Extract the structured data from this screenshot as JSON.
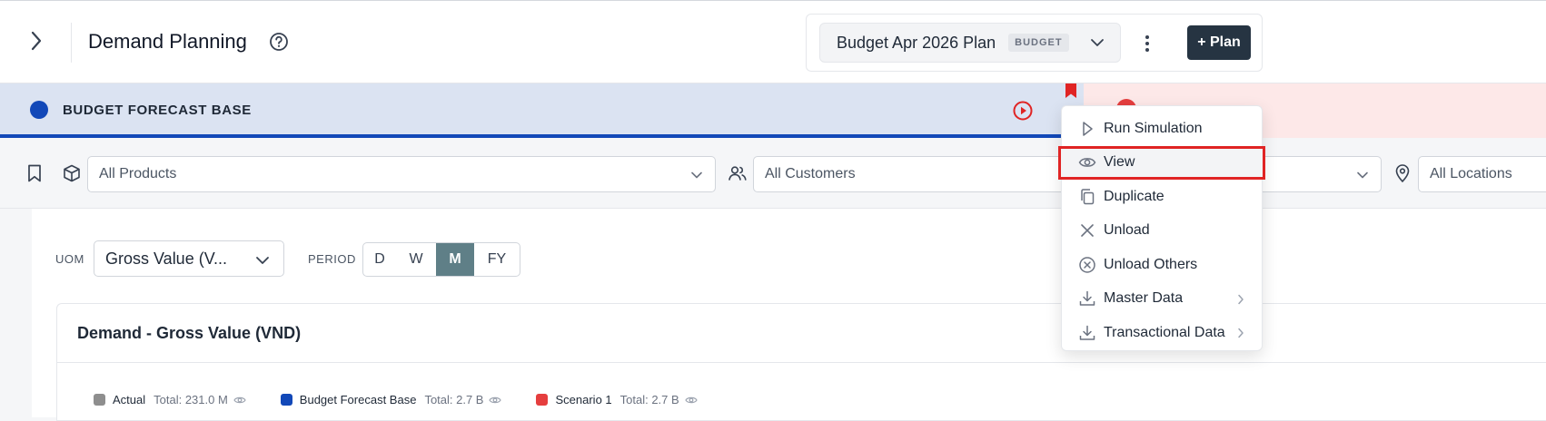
{
  "header": {
    "title": "Demand Planning",
    "plan_name": "Budget Apr 2026 Plan",
    "plan_badge": "BUDGET",
    "plan_button": "+ Plan"
  },
  "scenarios": {
    "base": {
      "label": "BUDGET FORECAST BASE",
      "color": "#1248b8"
    },
    "scenario1": {
      "color": "#e53e3e"
    }
  },
  "filters": {
    "products": "All Products",
    "customers": "All Customers",
    "locations": "All Locations"
  },
  "controls": {
    "uom_label": "UOM",
    "uom_value": "Gross Value (V...",
    "period_label": "PERIOD",
    "periods": [
      "D",
      "W",
      "M",
      "FY"
    ],
    "active_period": "M"
  },
  "chart": {
    "title": "Demand - Gross Value (VND)",
    "legend": [
      {
        "name": "Actual",
        "total": "Total: 231.0 M",
        "color": "#8e8e8e"
      },
      {
        "name": "Budget Forecast Base",
        "total": "Total: 2.7 B",
        "color": "#1248b8"
      },
      {
        "name": "Scenario 1",
        "total": "Total: 2.7 B",
        "color": "#e53e3e"
      }
    ]
  },
  "context_menu": {
    "items": [
      {
        "label": "Run Simulation",
        "icon": "play-outline-icon"
      },
      {
        "label": "View",
        "icon": "eye-icon",
        "highlighted": true
      },
      {
        "label": "Duplicate",
        "icon": "copy-icon"
      },
      {
        "label": "Unload",
        "icon": "close-icon"
      },
      {
        "label": "Unload Others",
        "icon": "close-circle-icon"
      },
      {
        "label": "Master Data",
        "icon": "download-icon",
        "submenu": true
      },
      {
        "label": "Transactional Data",
        "icon": "download-icon",
        "submenu": true
      }
    ]
  }
}
